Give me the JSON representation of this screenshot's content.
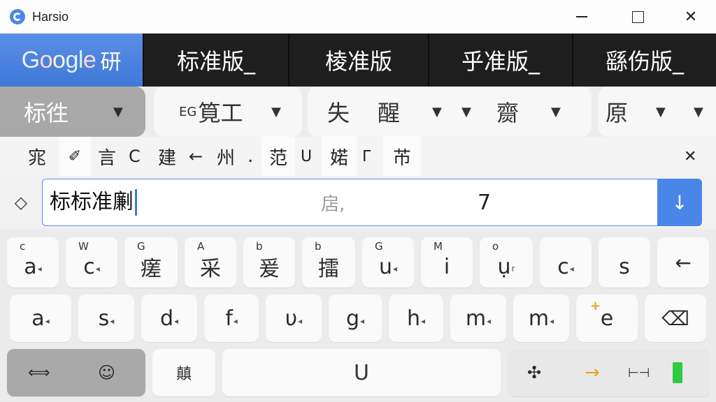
{
  "window": {
    "title": "Harsio",
    "minimize_label": "",
    "maximize_label": "",
    "close_label": "✕"
  },
  "modebar": {
    "google_letters": [
      "G",
      "o",
      "o",
      "g",
      "l",
      "e"
    ],
    "google_suffix": "研",
    "tabs": [
      "标准版_",
      "棱准版",
      "乎准版_",
      "繇伤版_"
    ]
  },
  "suggestions": {
    "first": "标徃",
    "second_prefix": "EG",
    "second": "筧工",
    "third_a": "失",
    "third_b": "醒",
    "third_c": "齌",
    "fourth": "原",
    "dropdown": "▼"
  },
  "quick_keys": [
    "宨",
    "✐",
    "言",
    "C",
    "建",
    "←",
    "州",
    ".",
    "范",
    "U",
    "婼",
    "ᒥ",
    "芇",
    "✕"
  ],
  "input": {
    "composition": "标标准劆",
    "middle_text": "扂,",
    "number": "7",
    "commit_icon": "↓",
    "back_icon": "◇"
  },
  "keys": {
    "row1": [
      {
        "hint": "c",
        "main": "a",
        "sub": "◂"
      },
      {
        "hint": "W",
        "main": "c",
        "sub": "◂"
      },
      {
        "hint": "G",
        "main": "瘥",
        "sub": ""
      },
      {
        "hint": "A",
        "main": "采",
        "sub": ""
      },
      {
        "hint": "b",
        "main": "爰",
        "sub": ""
      },
      {
        "hint": "b",
        "main": "擂",
        "sub": ""
      },
      {
        "hint": "G",
        "main": "u",
        "sub": "◂"
      },
      {
        "hint": "M",
        "main": "i",
        "sub": ""
      },
      {
        "hint": "o",
        "main": "ụ",
        "sub": "r"
      },
      {
        "hint": "",
        "main": "c",
        "sub": "◂"
      },
      {
        "hint": "",
        "main": "s",
        "sub": ""
      },
      {
        "hint": "",
        "main": "←",
        "sub": ""
      }
    ],
    "row2": [
      {
        "main": "a",
        "sub": "◂"
      },
      {
        "main": "s",
        "sub": "◂"
      },
      {
        "main": "d",
        "sub": "◂"
      },
      {
        "main": "f",
        "sub": "◂"
      },
      {
        "main": "υ",
        "sub": "◂"
      },
      {
        "main": "g",
        "sub": "◂"
      },
      {
        "main": "h",
        "sub": "◂"
      },
      {
        "main": "m",
        "sub": "◂"
      },
      {
        "main": "m",
        "sub": "◂"
      },
      {
        "main": "e",
        "sub": "",
        "plus": "+"
      },
      {
        "main": "⌫",
        "sub": ""
      }
    ],
    "row3": {
      "k1": "⟺",
      "k2": "☺",
      "k3": "㒹",
      "space": "U",
      "k5": "✣",
      "k6": "→",
      "k7": "⊢⊣"
    }
  },
  "colors": {
    "accent": "#4a86e8",
    "modebar": "#1e1e1e",
    "status_green": "#2ecc40",
    "arrow_orange": "#e8a317"
  }
}
